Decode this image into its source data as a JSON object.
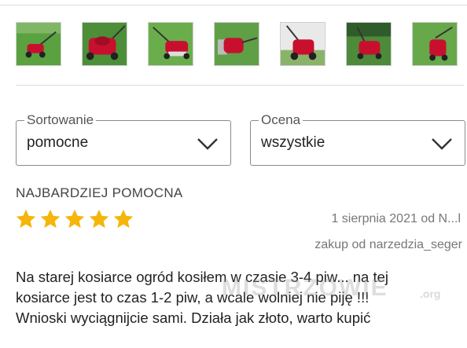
{
  "gallery": {
    "thumbnails": [
      {
        "alt": "mower-photo-1"
      },
      {
        "alt": "mower-photo-2"
      },
      {
        "alt": "mower-photo-3"
      },
      {
        "alt": "mower-photo-4"
      },
      {
        "alt": "mower-photo-5"
      },
      {
        "alt": "mower-photo-6"
      },
      {
        "alt": "mower-photo-7"
      }
    ]
  },
  "filters": {
    "sort": {
      "legend": "Sortowanie",
      "value": "pomocne",
      "icon": "chevron-down-icon"
    },
    "rating": {
      "legend": "Ocena",
      "value": "wszystkie",
      "icon": "chevron-down-icon"
    }
  },
  "review": {
    "section_title": "NAJBARDZIEJ POMOCNA",
    "stars": 5,
    "max_stars": 5,
    "date_author": "1 sierpnia 2021 od N...l",
    "source": "zakup od narzedzia_seger",
    "text_lines": [
      "Na starej kosiarce ogród kosiłem w czasie 3-4 piw... na tej",
      "kosiarce jest to czas 1-2 piw, a wcale wolniej nie piję !!!",
      "Wnioski wyciągnijcie sami. Działa jak złoto, warto kupić"
    ]
  },
  "watermark": {
    "text": "MISTRZOWIE",
    "suffix": ".org"
  },
  "colors": {
    "star": "#f5b50a",
    "border": "#8a8a8a",
    "grass": "#4f9a3a",
    "mower_body": "#c8102e"
  }
}
